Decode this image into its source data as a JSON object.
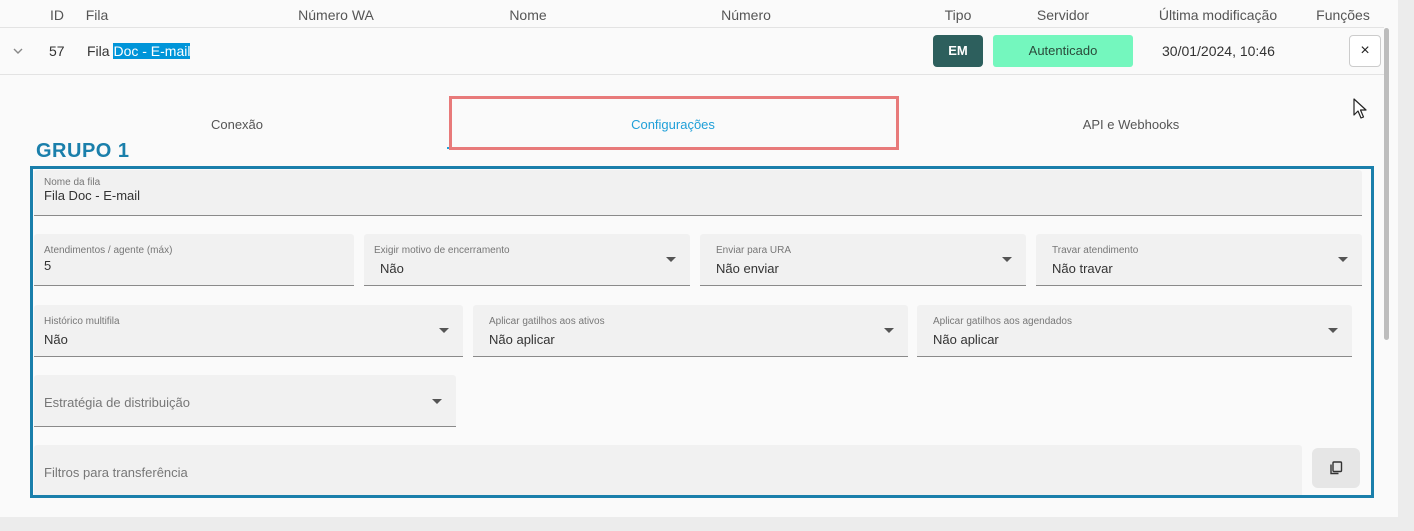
{
  "table": {
    "headers": {
      "id": "ID",
      "fila": "Fila",
      "numero_wa": "Número WA",
      "nome": "Nome",
      "numero": "Número",
      "tipo": "Tipo",
      "servidor": "Servidor",
      "ultima_modificacao": "Última modificação",
      "funcoes": "Funções"
    },
    "row": {
      "id": "57",
      "fila_prefix": "Fila ",
      "fila_highlight": "Doc - E-mail",
      "tipo": "EM",
      "servidor": "Autenticado",
      "ultima_modificacao": "30/01/2024, 10:46",
      "close": "×"
    }
  },
  "tabs": [
    {
      "label": "Conexão"
    },
    {
      "label": "Configurações",
      "active": true
    },
    {
      "label": "API e Webhooks"
    }
  ],
  "group_label": "GRUPO 1",
  "form": {
    "nome_da_fila": {
      "label": "Nome da fila",
      "value": "Fila Doc - E-mail"
    },
    "atendimentos": {
      "label": "Atendimentos / agente (máx)",
      "value": "5"
    },
    "exigir_motivo": {
      "label": "Exigir motivo de encerramento",
      "value": "Não"
    },
    "enviar_ura": {
      "label": "Enviar para URA",
      "value": "Não enviar"
    },
    "travar": {
      "label": "Travar atendimento",
      "value": "Não travar"
    },
    "historico": {
      "label": "Histórico multifila",
      "value": "Não"
    },
    "gatilhos_ativos": {
      "label": "Aplicar gatilhos aos ativos",
      "value": "Não aplicar"
    },
    "gatilhos_agendados": {
      "label": "Aplicar gatilhos aos agendados",
      "value": "Não aplicar"
    },
    "estrategia": {
      "placeholder": "Estratégia de distribuição"
    },
    "filtros": {
      "placeholder": "Filtros para transferência"
    }
  },
  "colors": {
    "accent": "#1e9fd8",
    "group_border": "#1a7fab",
    "tab_highlight": "#e87a7a",
    "badge_em": "#2d5f5d",
    "badge_auth": "#74f7be"
  },
  "icons": [
    "chevron-down-icon",
    "close-icon",
    "cursor-icon",
    "dropdown-arrow-icon",
    "copy-icon"
  ]
}
